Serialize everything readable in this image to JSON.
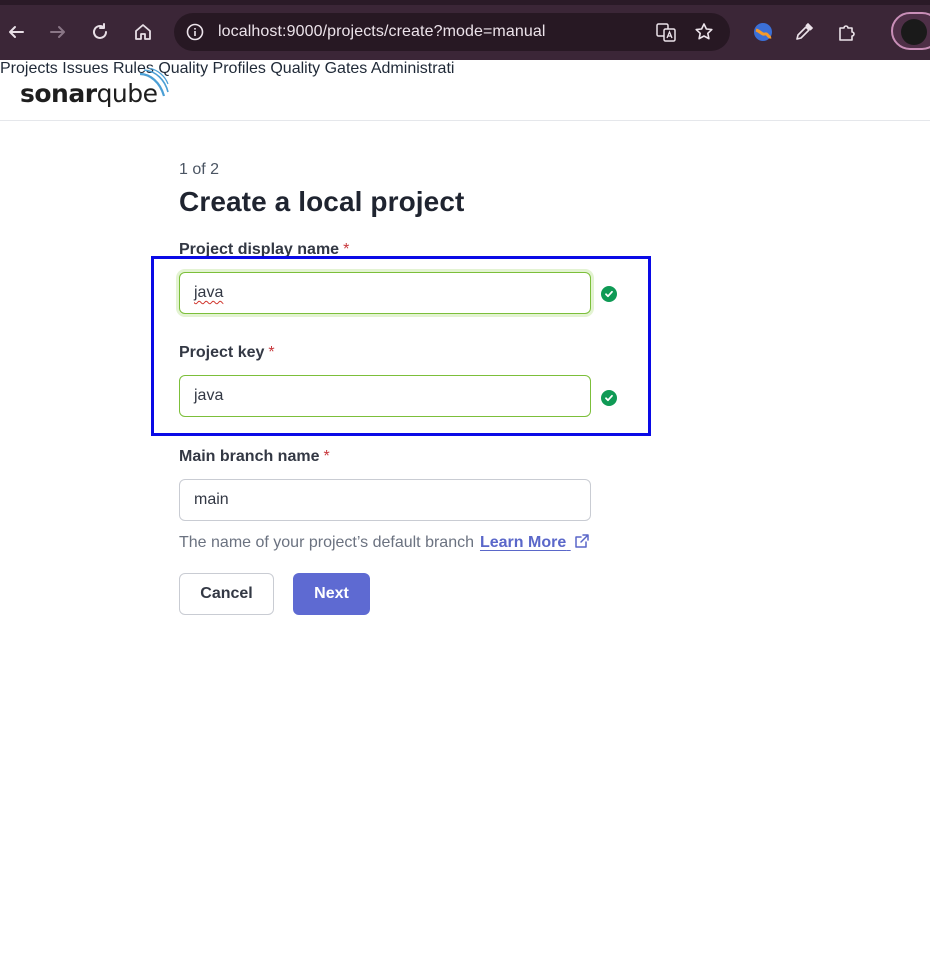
{
  "browser": {
    "url": "localhost:9000/projects/create?mode=manual",
    "accent_color": "#3b2637"
  },
  "app": {
    "logo_prefix": "sonar",
    "logo_suffix": "qube",
    "nav": [
      "Projects",
      "Issues",
      "Rules",
      "Quality Profiles",
      "Quality Gates",
      "Administrati"
    ]
  },
  "form": {
    "step": "1 of 2",
    "title": "Create a local project",
    "display_name_label": "Project display name",
    "display_name_value": "java",
    "project_key_label": "Project key",
    "project_key_value": "java",
    "branch_label": "Main branch name",
    "branch_value": "main",
    "required_mark": "*",
    "helper_text": "The name of your project’s default branch",
    "learn_more": "Learn More",
    "cancel_label": "Cancel",
    "next_label": "Next"
  },
  "colors": {
    "primary": "#5e6ad2",
    "valid": "#0f9a55",
    "highlight": "#0a0ae6"
  }
}
